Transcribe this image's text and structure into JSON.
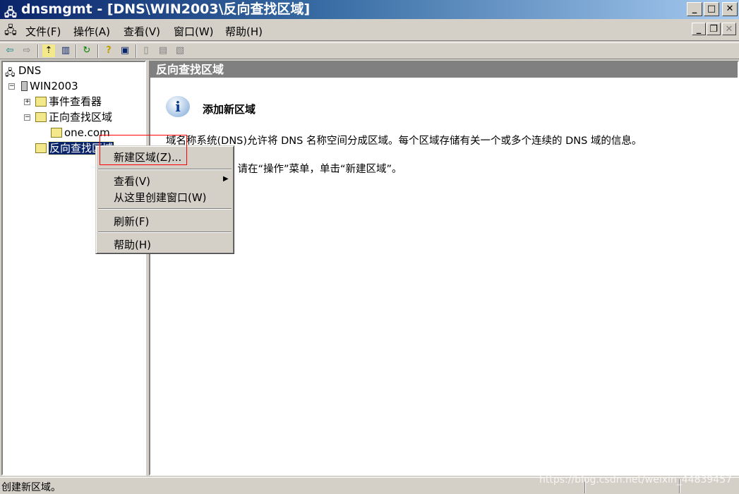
{
  "window": {
    "title": "dnsmgmt - [DNS\\WIN2003\\反向查找区域]",
    "buttons": [
      "minimize",
      "maximize",
      "close"
    ]
  },
  "menubar": {
    "items": [
      "文件(F)",
      "操作(A)",
      "查看(V)",
      "窗口(W)",
      "帮助(H)"
    ]
  },
  "toolbar": {
    "icons": [
      "back-icon",
      "forward-icon",
      "up-folder-icon",
      "show-hide-tree-icon",
      "refresh-icon",
      "help-icon",
      "properties-icon",
      "server-icon",
      "list-icon",
      "zone-icon"
    ]
  },
  "tree": {
    "root": "DNS",
    "server": "WIN2003",
    "event_viewer": "事件查看器",
    "forward_zones": "正向查找区域",
    "zone": "one.com",
    "reverse_zones": "反向查找区域"
  },
  "right": {
    "header": "反向查找区域",
    "heading": "添加新区域",
    "para1": "域名称系统(DNS)允许将 DNS 名称空间分成区域。每个区域存储有关一个或多个连续的 DNS 域的信息。",
    "para2": "要添加新区域，请在“操作”菜单，单击“新建区域”。"
  },
  "context_menu": {
    "new_zone": "新建区域(Z)...",
    "view": "查看(V)",
    "new_window": "从这里创建窗口(W)",
    "refresh": "刷新(F)",
    "help": "帮助(H)"
  },
  "status": {
    "text": "创建新区域。",
    "watermark": "https://blog.csdn.net/weixin_44839457"
  },
  "colors": {
    "selection": "#0a246a",
    "highlight_box": "#ff0000"
  }
}
